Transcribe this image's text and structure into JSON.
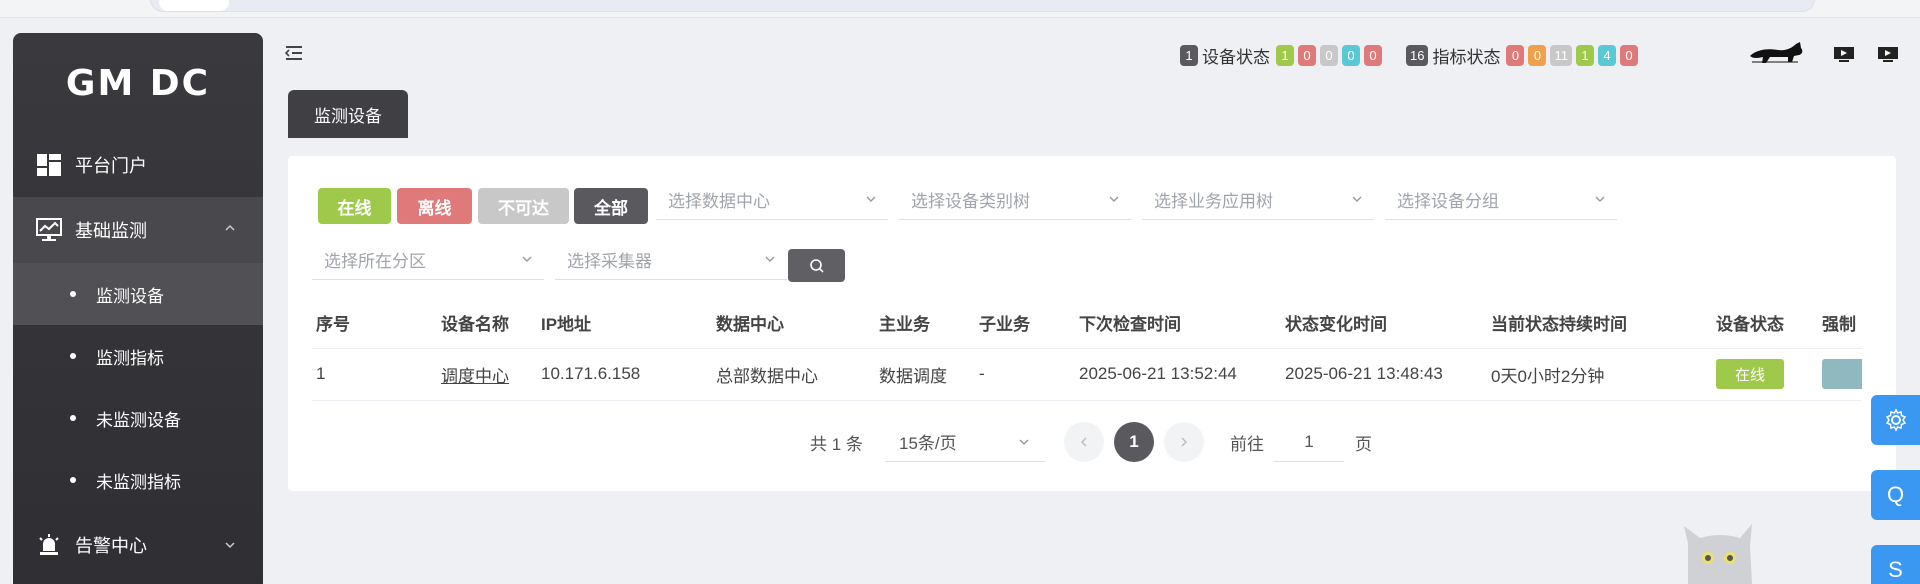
{
  "app": {
    "logo": "GM DC"
  },
  "sidebar": {
    "items": [
      {
        "label": "平台门户",
        "icon": "dashboard-icon"
      },
      {
        "label": "基础监测",
        "icon": "monitor-chart-icon",
        "expanded": true,
        "children": [
          {
            "label": "监测设备",
            "active": true
          },
          {
            "label": "监测指标"
          },
          {
            "label": "未监测设备"
          },
          {
            "label": "未监测指标"
          }
        ]
      },
      {
        "label": "告警中心",
        "icon": "alarm-light-icon"
      }
    ]
  },
  "header": {
    "device_status": {
      "total": "1",
      "label": "设备状态",
      "counts": [
        "1",
        "0",
        "0",
        "0",
        "0"
      ]
    },
    "metric_status": {
      "total": "16",
      "label": "指标状态",
      "counts": [
        "0",
        "0",
        "11",
        "1",
        "4",
        "0"
      ]
    }
  },
  "tab": {
    "label": "监测设备"
  },
  "filters": {
    "buttons": {
      "online": "在线",
      "offline": "离线",
      "unreachable": "不可达",
      "all": "全部"
    },
    "selects": {
      "datacenter": "选择数据中心",
      "device_tree": "选择设备类别树",
      "business_tree": "选择业务应用树",
      "device_group": "选择设备分组",
      "zone": "选择所在分区",
      "collector": "选择采集器"
    }
  },
  "table": {
    "columns": [
      "序号",
      "设备名称",
      "IP地址",
      "数据中心",
      "主业务",
      "子业务",
      "下次检查时间",
      "状态变化时间",
      "当前状态持续时间",
      "设备状态",
      "强制"
    ],
    "rows": [
      {
        "index": "1",
        "name": "调度中心",
        "ip": "10.171.6.158",
        "datacenter": "总部数据中心",
        "main_business": "数据调度",
        "sub_business": "-",
        "next_check": "2025-06-21 13:52:44",
        "status_change": "2025-06-21 13:48:43",
        "duration": "0天0小时2分钟",
        "status": "在线"
      }
    ]
  },
  "pagination": {
    "total_text": "共 1 条",
    "page_size": "15条/页",
    "current_page": "1",
    "goto_prefix": "前往",
    "goto_value": "1",
    "goto_suffix": "页"
  },
  "float_buttons": {
    "q": "Q",
    "s": "S"
  },
  "colors": {
    "online": "#9ec94a",
    "offline": "#e07a7a",
    "unreachable": "#c8c8c8",
    "all": "#5a5a5e",
    "blue": "#5bc8d6",
    "orange": "#f0a04b",
    "float_blue": "#3a97f2"
  }
}
